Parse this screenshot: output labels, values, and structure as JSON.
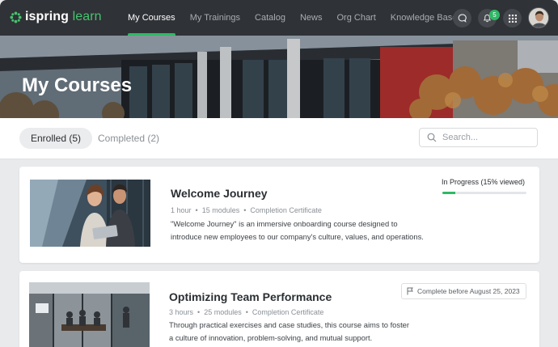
{
  "app": {
    "logo_prefix": "ispring",
    "logo_suffix": "learn",
    "brand_color": "#2fb866"
  },
  "nav": {
    "items": [
      {
        "label": "My Courses",
        "active": true
      },
      {
        "label": "My Trainings",
        "active": false
      },
      {
        "label": "Catalog",
        "active": false
      },
      {
        "label": "News",
        "active": false
      },
      {
        "label": "Org Chart",
        "active": false
      },
      {
        "label": "Knowledge Base",
        "active": false
      }
    ],
    "notification_count": "5",
    "icons": [
      "chat-icon",
      "bell-icon",
      "apps-grid-icon"
    ]
  },
  "hero": {
    "title": "My Courses"
  },
  "tabs": [
    {
      "label": "Enrolled (5)",
      "active": true
    },
    {
      "label": "Completed (2)",
      "active": false
    }
  ],
  "search": {
    "placeholder": "Search...",
    "value": ""
  },
  "courses": [
    {
      "title": "Welcome Journey",
      "duration": "1 hour",
      "modules": "15 modules",
      "certificate": "Completion Certificate",
      "description": "\"Welcome Journey\" is an immersive onboarding course designed to introduce new employees to our company's culture, values, and operations.",
      "status": "In Progress (15% viewed)",
      "progress": 0.15
    },
    {
      "title": "Optimizing Team Performance",
      "duration": "3 hours",
      "modules": "25 modules",
      "certificate": "Completion Certificate",
      "description": "Through practical exercises and case studies, this course aims to foster a culture of innovation, problem-solving, and mutual support.",
      "deadline": "Complete before August 25, 2023"
    }
  ]
}
